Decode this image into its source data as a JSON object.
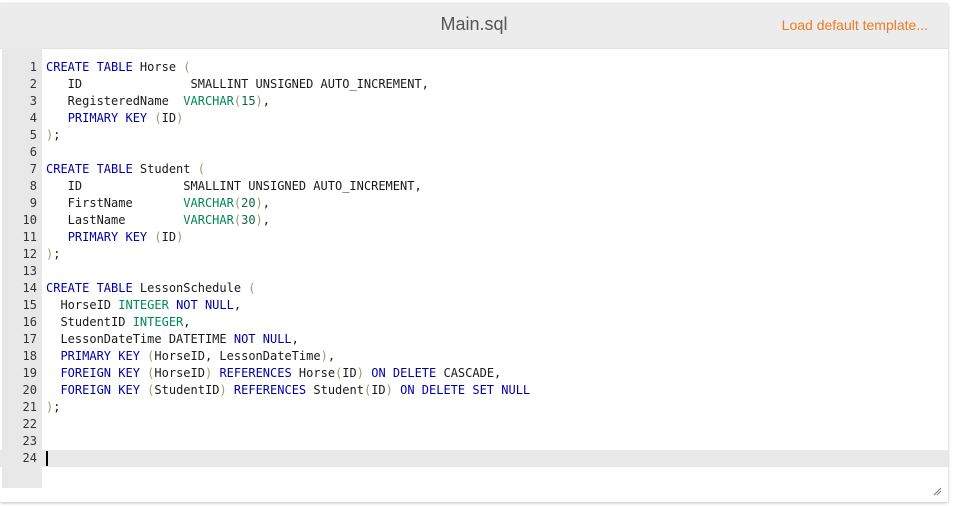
{
  "header": {
    "title": "Main.sql",
    "template_link": "Load default template..."
  },
  "colors": {
    "keyword": "#0000aa",
    "type": "#008855",
    "number": "#116644",
    "paren": "#999977",
    "link": "#ec7c27"
  },
  "editor": {
    "active_line": 24,
    "lines": [
      {
        "n": "1",
        "tokens": [
          {
            "t": "CREATE TABLE",
            "c": "kw"
          },
          {
            "t": " Horse ",
            "c": "txt"
          },
          {
            "t": "(",
            "c": "pn"
          }
        ]
      },
      {
        "n": "2",
        "tokens": [
          {
            "t": "   ID               SMALLINT UNSIGNED AUTO_INCREMENT,",
            "c": "txt"
          }
        ]
      },
      {
        "n": "3",
        "tokens": [
          {
            "t": "   RegisteredName  ",
            "c": "txt"
          },
          {
            "t": "VARCHAR",
            "c": "type"
          },
          {
            "t": "(",
            "c": "pn"
          },
          {
            "t": "15",
            "c": "num"
          },
          {
            "t": ")",
            "c": "pn"
          },
          {
            "t": ",",
            "c": "txt"
          }
        ]
      },
      {
        "n": "4",
        "tokens": [
          {
            "t": "   ",
            "c": "txt"
          },
          {
            "t": "PRIMARY KEY",
            "c": "kw"
          },
          {
            "t": " ",
            "c": "txt"
          },
          {
            "t": "(",
            "c": "pn"
          },
          {
            "t": "ID",
            "c": "txt"
          },
          {
            "t": ")",
            "c": "pn"
          }
        ]
      },
      {
        "n": "5",
        "tokens": [
          {
            "t": ")",
            "c": "pn"
          },
          {
            "t": ";",
            "c": "txt"
          }
        ]
      },
      {
        "n": "6",
        "tokens": []
      },
      {
        "n": "7",
        "tokens": [
          {
            "t": "CREATE TABLE",
            "c": "kw"
          },
          {
            "t": " Student ",
            "c": "txt"
          },
          {
            "t": "(",
            "c": "pn"
          }
        ]
      },
      {
        "n": "8",
        "tokens": [
          {
            "t": "   ID              SMALLINT UNSIGNED AUTO_INCREMENT,",
            "c": "txt"
          }
        ]
      },
      {
        "n": "9",
        "tokens": [
          {
            "t": "   FirstName       ",
            "c": "txt"
          },
          {
            "t": "VARCHAR",
            "c": "type"
          },
          {
            "t": "(",
            "c": "pn"
          },
          {
            "t": "20",
            "c": "num"
          },
          {
            "t": ")",
            "c": "pn"
          },
          {
            "t": ",",
            "c": "txt"
          }
        ]
      },
      {
        "n": "10",
        "tokens": [
          {
            "t": "   LastName        ",
            "c": "txt"
          },
          {
            "t": "VARCHAR",
            "c": "type"
          },
          {
            "t": "(",
            "c": "pn"
          },
          {
            "t": "30",
            "c": "num"
          },
          {
            "t": ")",
            "c": "pn"
          },
          {
            "t": ",",
            "c": "txt"
          }
        ]
      },
      {
        "n": "11",
        "tokens": [
          {
            "t": "   ",
            "c": "txt"
          },
          {
            "t": "PRIMARY KEY",
            "c": "kw"
          },
          {
            "t": " ",
            "c": "txt"
          },
          {
            "t": "(",
            "c": "pn"
          },
          {
            "t": "ID",
            "c": "txt"
          },
          {
            "t": ")",
            "c": "pn"
          }
        ]
      },
      {
        "n": "12",
        "tokens": [
          {
            "t": ")",
            "c": "pn"
          },
          {
            "t": ";",
            "c": "txt"
          }
        ]
      },
      {
        "n": "13",
        "tokens": []
      },
      {
        "n": "14",
        "tokens": [
          {
            "t": "CREATE TABLE",
            "c": "kw"
          },
          {
            "t": " LessonSchedule ",
            "c": "txt"
          },
          {
            "t": "(",
            "c": "pn"
          }
        ]
      },
      {
        "n": "15",
        "tokens": [
          {
            "t": "  HorseID ",
            "c": "txt"
          },
          {
            "t": "INTEGER",
            "c": "type"
          },
          {
            "t": " ",
            "c": "txt"
          },
          {
            "t": "NOT NULL",
            "c": "kw"
          },
          {
            "t": ",",
            "c": "txt"
          }
        ]
      },
      {
        "n": "16",
        "tokens": [
          {
            "t": "  StudentID ",
            "c": "txt"
          },
          {
            "t": "INTEGER",
            "c": "type"
          },
          {
            "t": ",",
            "c": "txt"
          }
        ]
      },
      {
        "n": "17",
        "tokens": [
          {
            "t": "  LessonDateTime DATETIME ",
            "c": "txt"
          },
          {
            "t": "NOT NULL",
            "c": "kw"
          },
          {
            "t": ",",
            "c": "txt"
          }
        ]
      },
      {
        "n": "18",
        "tokens": [
          {
            "t": "  ",
            "c": "txt"
          },
          {
            "t": "PRIMARY KEY",
            "c": "kw"
          },
          {
            "t": " ",
            "c": "txt"
          },
          {
            "t": "(",
            "c": "pn"
          },
          {
            "t": "HorseID, LessonDateTime",
            "c": "txt"
          },
          {
            "t": ")",
            "c": "pn"
          },
          {
            "t": ",",
            "c": "txt"
          }
        ]
      },
      {
        "n": "19",
        "tokens": [
          {
            "t": "  ",
            "c": "txt"
          },
          {
            "t": "FOREIGN KEY",
            "c": "kw"
          },
          {
            "t": " ",
            "c": "txt"
          },
          {
            "t": "(",
            "c": "pn"
          },
          {
            "t": "HorseID",
            "c": "txt"
          },
          {
            "t": ")",
            "c": "pn"
          },
          {
            "t": " ",
            "c": "txt"
          },
          {
            "t": "REFERENCES",
            "c": "kw"
          },
          {
            "t": " Horse",
            "c": "txt"
          },
          {
            "t": "(",
            "c": "pn"
          },
          {
            "t": "ID",
            "c": "txt"
          },
          {
            "t": ")",
            "c": "pn"
          },
          {
            "t": " ",
            "c": "txt"
          },
          {
            "t": "ON DELETE",
            "c": "kw"
          },
          {
            "t": " CASCADE,",
            "c": "txt"
          }
        ]
      },
      {
        "n": "20",
        "tokens": [
          {
            "t": "  ",
            "c": "txt"
          },
          {
            "t": "FOREIGN KEY",
            "c": "kw"
          },
          {
            "t": " ",
            "c": "txt"
          },
          {
            "t": "(",
            "c": "pn"
          },
          {
            "t": "StudentID",
            "c": "txt"
          },
          {
            "t": ")",
            "c": "pn"
          },
          {
            "t": " ",
            "c": "txt"
          },
          {
            "t": "REFERENCES",
            "c": "kw"
          },
          {
            "t": " Student",
            "c": "txt"
          },
          {
            "t": "(",
            "c": "pn"
          },
          {
            "t": "ID",
            "c": "txt"
          },
          {
            "t": ")",
            "c": "pn"
          },
          {
            "t": " ",
            "c": "txt"
          },
          {
            "t": "ON DELETE SET NULL",
            "c": "kw"
          }
        ]
      },
      {
        "n": "21",
        "tokens": [
          {
            "t": ")",
            "c": "pn"
          },
          {
            "t": ";",
            "c": "txt"
          }
        ]
      },
      {
        "n": "22",
        "tokens": []
      },
      {
        "n": "23",
        "tokens": []
      },
      {
        "n": "24",
        "tokens": []
      }
    ]
  }
}
